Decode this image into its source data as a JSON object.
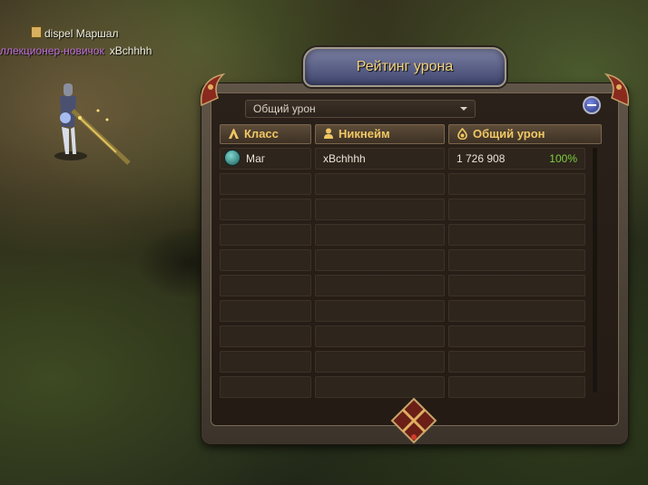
{
  "world": {
    "nameplate_name": "dispel Маршал",
    "subplate_title": "ллекционер-новичок",
    "subplate_player": "xBchhhh"
  },
  "panel": {
    "title": "Рейтинг урона",
    "filter": {
      "selected": "Общий урон"
    },
    "columns": [
      {
        "label": "Класс",
        "icon": "class-icon"
      },
      {
        "label": "Никнейм",
        "icon": "player-icon"
      },
      {
        "label": "Общий урон",
        "icon": "damage-icon"
      }
    ],
    "rows": [
      {
        "class": "Маг",
        "nickname": "xBchhhh",
        "damage": "1 726 908",
        "percent": "100%"
      }
    ],
    "empty_row_count": 9,
    "accent_color": "#f0c764",
    "percent_color": "#7dcf3c"
  }
}
